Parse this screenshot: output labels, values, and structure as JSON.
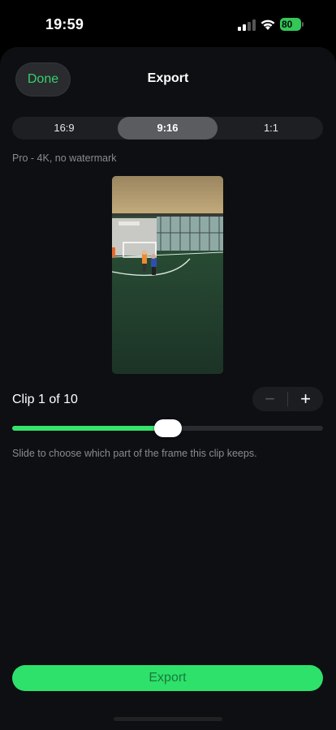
{
  "status_bar": {
    "time": "19:59",
    "battery": "80",
    "icons": [
      "signal-icon",
      "wifi-icon",
      "battery-icon"
    ]
  },
  "header": {
    "done_label": "Done",
    "title": "Export"
  },
  "aspect_ratio": {
    "options": [
      "16:9",
      "9:16",
      "1:1"
    ],
    "selected": "9:16"
  },
  "plan_note": "Pro - 4K, no watermark",
  "clip": {
    "label": "Clip 1 of 10",
    "minus": "−",
    "plus": "+"
  },
  "slider": {
    "value": 0.5
  },
  "hint": "Slide to choose which part of the frame this clip keeps.",
  "export_label": "Export",
  "colors": {
    "accent": "#2ee16a",
    "background": "#0e0f12"
  }
}
